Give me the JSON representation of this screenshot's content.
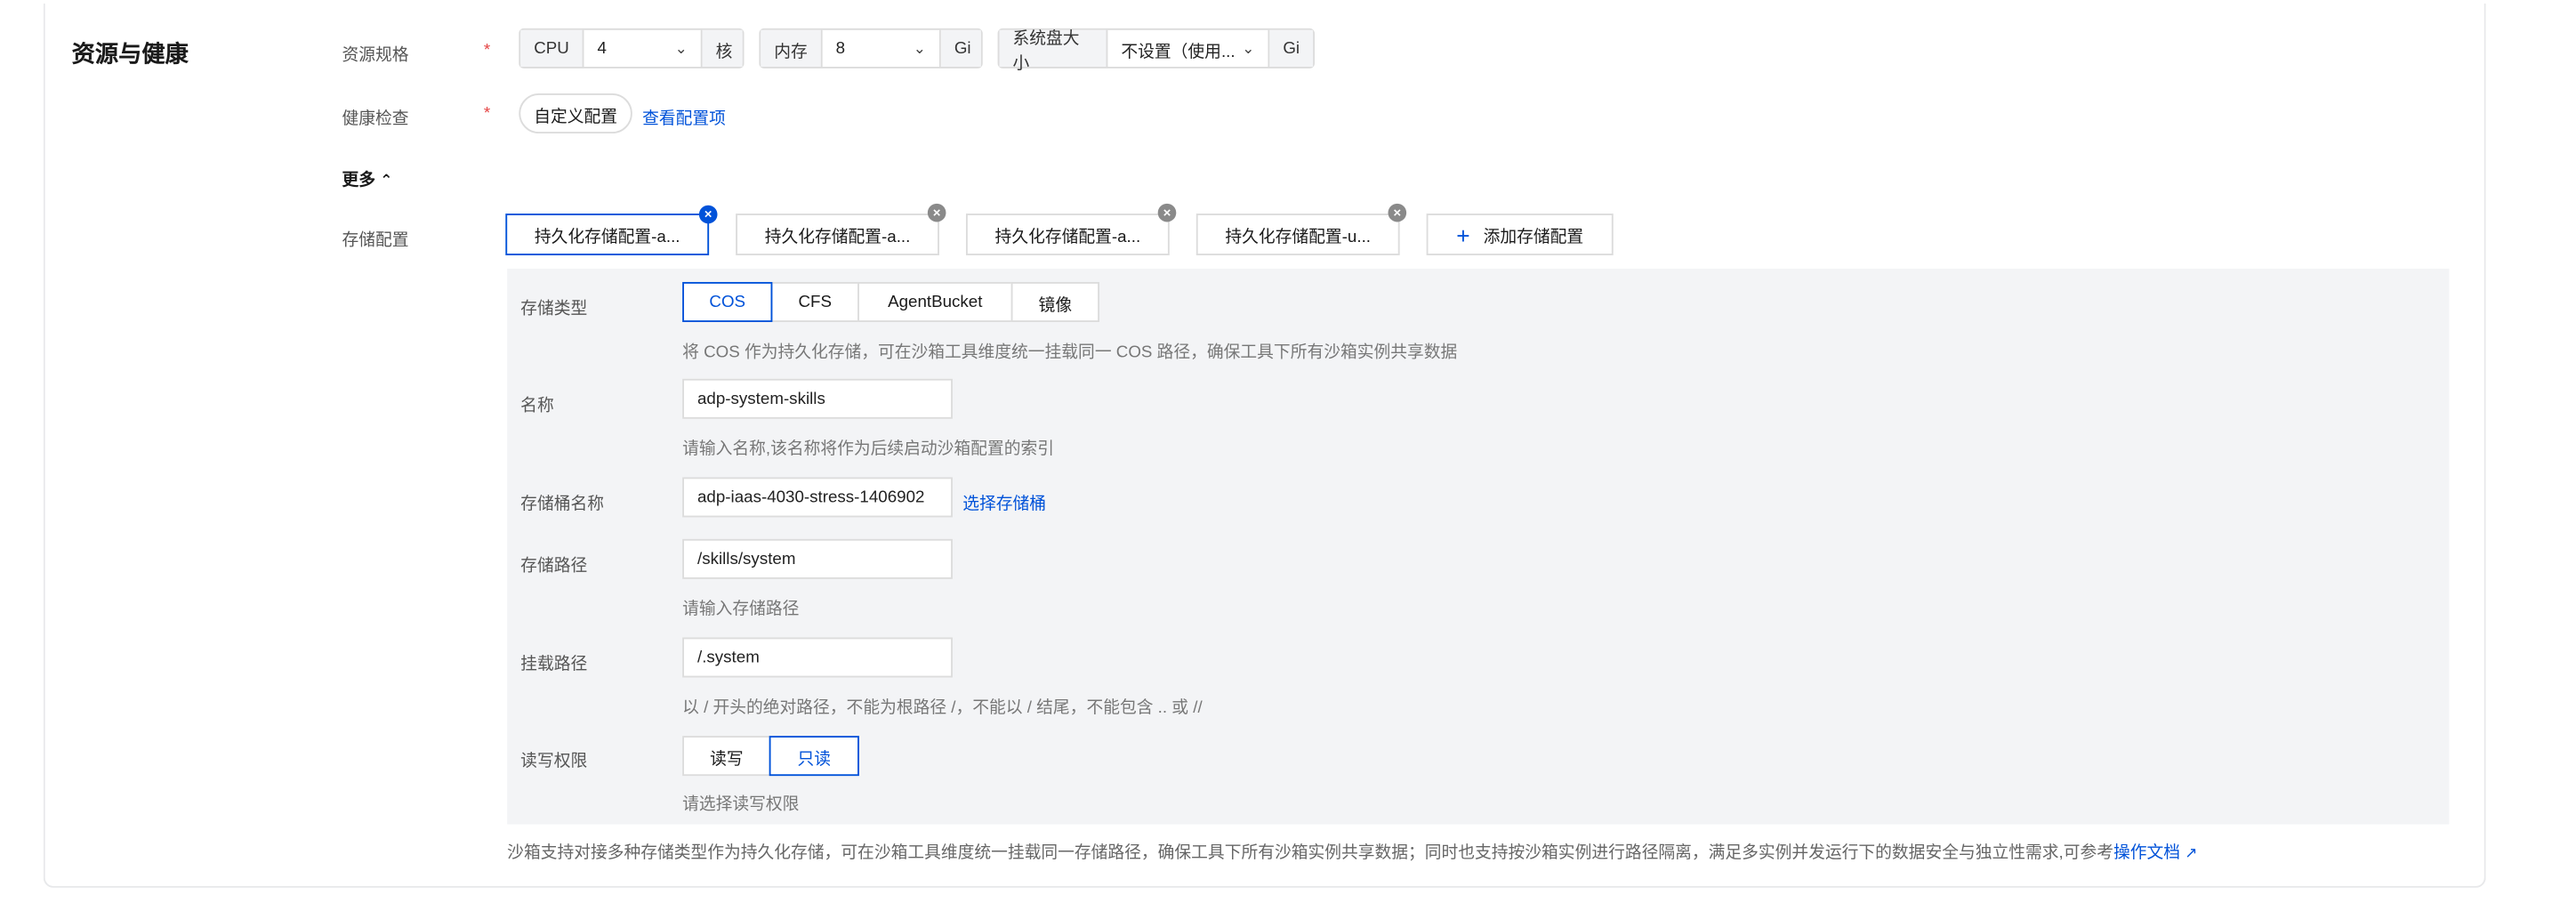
{
  "section": {
    "title": "资源与健康"
  },
  "resource": {
    "label": "资源规格",
    "required_mark": "*",
    "cpu": {
      "prefix": "CPU",
      "value": "4",
      "unit": "核"
    },
    "memory": {
      "prefix": "内存",
      "value": "8",
      "unit": "Gi"
    },
    "disk": {
      "prefix": "系统盘大小",
      "value": "不设置（使用...",
      "unit": "Gi"
    }
  },
  "health": {
    "label": "健康检查",
    "required_mark": "*",
    "button": "自定义配置",
    "link": "查看配置项"
  },
  "more": {
    "label": "更多",
    "icon": "chevron-up-icon"
  },
  "storage": {
    "label": "存储配置",
    "tabs": [
      "持久化存储配置-a...",
      "持久化存储配置-a...",
      "持久化存储配置-a...",
      "持久化存储配置-u..."
    ],
    "add_label": "添加存储配置",
    "accent": "#0052d9",
    "form": {
      "type": {
        "label": "存储类型",
        "options": [
          "COS",
          "CFS",
          "AgentBucket",
          "镜像"
        ],
        "selected": "COS",
        "hint": "将 COS 作为持久化存储，可在沙箱工具维度统一挂载同一 COS 路径，确保工具下所有沙箱实例共享数据"
      },
      "name": {
        "label": "名称",
        "value": "adp-system-skills",
        "hint": "请输入名称,该名称将作为后续启动沙箱配置的索引"
      },
      "bucket": {
        "label": "存储桶名称",
        "value": "adp-iaas-4030-stress-1406902",
        "link": "选择存储桶"
      },
      "path": {
        "label": "存储路径",
        "value": "/skills/system",
        "hint": "请输入存储路径"
      },
      "mount": {
        "label": "挂载路径",
        "value": "/.system",
        "hint": "以 / 开头的绝对路径，不能为根路径 /，不能以 / 结尾，不能包含 .. 或 //"
      },
      "perm": {
        "label": "读写权限",
        "options": [
          "读写",
          "只读"
        ],
        "selected": "只读",
        "hint": "请选择读写权限"
      }
    },
    "footnote": "沙箱支持对接多种存储类型作为持久化存储，可在沙箱工具维度统一挂载同一存储路径，确保工具下所有沙箱实例共享数据；同时也支持按沙箱实例进行路径隔离，满足多实例并发运行下的数据安全与独立性需求,可参考",
    "doc_link": "操作文档"
  }
}
